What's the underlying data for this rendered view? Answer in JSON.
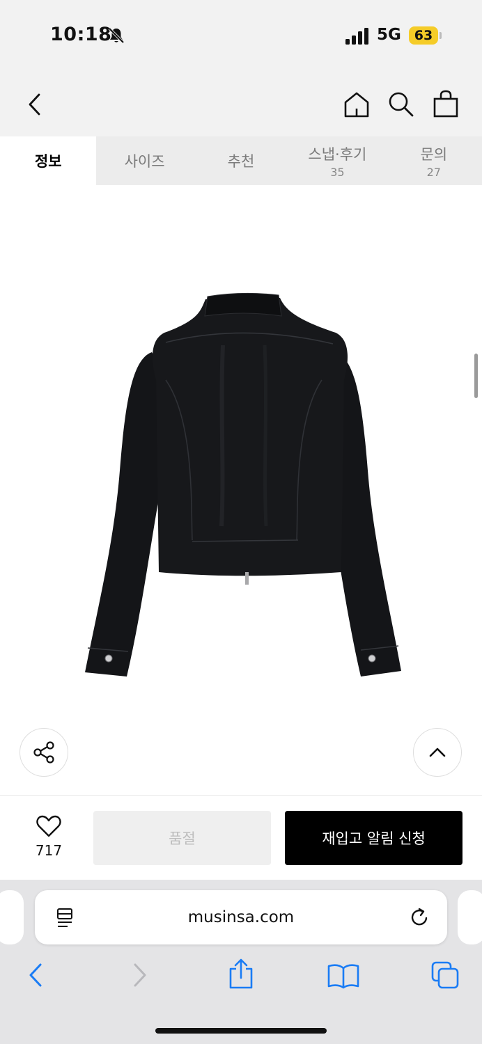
{
  "status_bar": {
    "time": "10:18",
    "network": "5G",
    "battery": "63"
  },
  "icons": {
    "bell_off": "bell-slash-icon",
    "signal": "cellular-signal-icon",
    "back": "chevron-left-icon",
    "home": "home-icon",
    "search": "search-icon",
    "bag": "shopping-bag-icon",
    "share": "share-icon",
    "top": "chevron-up-icon",
    "heart": "heart-icon",
    "reader": "reader-mode-icon",
    "reload": "reload-icon",
    "browser_back": "chevron-left-icon",
    "browser_forward": "chevron-right-icon",
    "browser_share": "share-sheet-icon",
    "bookmarks": "book-icon",
    "tabs": "tabs-icon"
  },
  "tabs": [
    {
      "label": "정보",
      "count": ""
    },
    {
      "label": "사이즈",
      "count": ""
    },
    {
      "label": "추천",
      "count": ""
    },
    {
      "label": "스냅·후기",
      "count": "35"
    },
    {
      "label": "문의",
      "count": "27"
    }
  ],
  "product": {
    "image": "black-leather-jacket-back-view"
  },
  "actions": {
    "like_count": "717",
    "soldout_label": "품절",
    "restock_label": "재입고 알림 신청"
  },
  "browser": {
    "url": "musinsa.com"
  },
  "colors": {
    "accent": "#000000",
    "disabled_bg": "#efefef",
    "disabled_text": "#bdbdbd",
    "safari_blue": "#1a7cf5",
    "battery": "#f5cc28"
  }
}
